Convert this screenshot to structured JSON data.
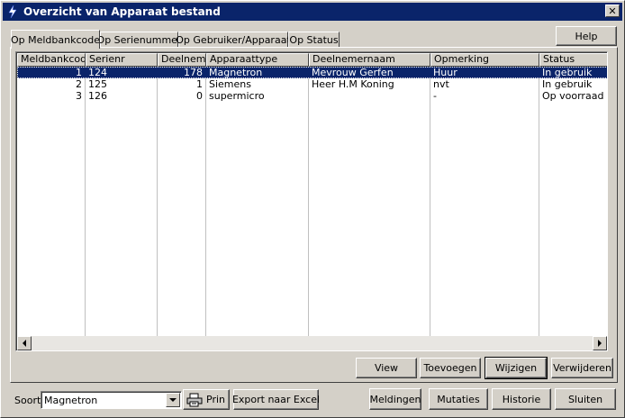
{
  "window": {
    "title": "Overzicht van Apparaat bestand",
    "close_glyph": "✕"
  },
  "tabs": [
    {
      "label": "Op Meldbankcode",
      "active": true
    },
    {
      "label": "Op Serienummer",
      "active": false
    },
    {
      "label": "Op Gebruiker/Apparaat",
      "active": false
    },
    {
      "label": "Op Status",
      "active": false
    }
  ],
  "buttons": {
    "help": "Help",
    "view": "View",
    "toevoegen": "Toevoegen",
    "wijzigen": "Wijzigen",
    "verwijderen": "Verwijderen",
    "print": "Prin",
    "export": "Export naar Excel",
    "meldingen": "Meldingen",
    "mutaties": "Mutaties",
    "historie": "Historie",
    "sluiten": "Sluiten"
  },
  "table": {
    "columns": [
      "Meldbankcode",
      "Serienr",
      "Deelnemer",
      "Apparaattype",
      "Deelnemernaam",
      "Opmerking",
      "Status"
    ],
    "rows": [
      [
        "1",
        "124",
        "178",
        "Magnetron",
        "Mevrouw Gerfen",
        "Huur",
        "In gebruik"
      ],
      [
        "2",
        "125",
        "1",
        "Siemens",
        "Heer H.M Koning",
        "nvt",
        "In gebruik"
      ],
      [
        "3",
        "126",
        "0",
        "supermicro",
        "",
        "-",
        "Op voorraad"
      ]
    ],
    "selected_row": 0
  },
  "sort": {
    "label": "Soort:",
    "value": "Magnetron"
  },
  "icons": {
    "app": "app-icon",
    "close": "close-icon",
    "printer": "printer-icon",
    "dropdown": "chevron-down-icon",
    "scroll_left": "arrow-left-icon",
    "scroll_right": "arrow-right-icon"
  },
  "colors": {
    "titlebar": "#0a246a",
    "face": "#d4d0c8",
    "selection": "#0a246a"
  }
}
